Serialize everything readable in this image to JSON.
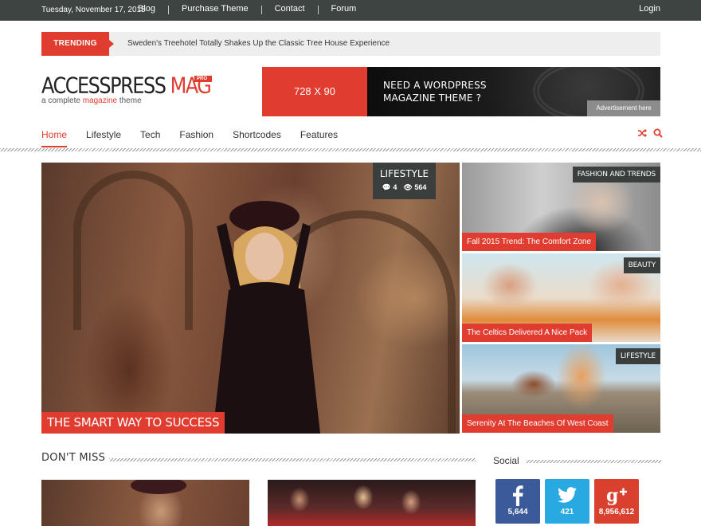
{
  "topbar": {
    "date": "Tuesday, November 17, 2015",
    "nav": [
      "Blog",
      "Purchase Theme",
      "Contact",
      "Forum"
    ],
    "login": "Login",
    "background": "#3d4442"
  },
  "trending": {
    "label": "TRENDING",
    "headline": "Sweden's Treehotel Totally Shakes Up the Classic Tree House Experience"
  },
  "logo": {
    "name_main": "ACCESSPRESS",
    "name_accent": "MAG",
    "badge": "PRO",
    "tagline_prefix": "a complete",
    "tagline_accent": "magazine",
    "tagline_suffix": "theme"
  },
  "ad": {
    "size": "728 X 90",
    "line1": "NEED A WORDPRESS",
    "line2": "MAGAZINE THEME ?",
    "link": "Advertisement here"
  },
  "mainnav": {
    "items": [
      "Home",
      "Lifestyle",
      "Tech",
      "Fashion",
      "Shortcodes",
      "Features"
    ],
    "active": "Home",
    "icons": [
      "shuffle-icon",
      "search-icon"
    ]
  },
  "hero": {
    "category": "LIFESTYLE",
    "comments": "4",
    "views": "564",
    "title": "THE SMART WAY TO SUCCESS"
  },
  "side_posts": [
    {
      "category": "FASHION AND TRENDS",
      "title": "Fall 2015 Trend: The Comfort Zone"
    },
    {
      "category": "BEAUTY",
      "title": "The Celtics Delivered A Nice Pack"
    },
    {
      "category": "LIFESTYLE",
      "title": "Serenity At The Beaches Of West Coast"
    }
  ],
  "dont_miss": {
    "heading": "DON'T MISS"
  },
  "social": {
    "heading": "Social",
    "items": [
      {
        "network": "facebook",
        "icon": "facebook-icon",
        "count": "5,644",
        "color": "#3b5a9a"
      },
      {
        "network": "twitter",
        "icon": "twitter-icon",
        "count": "421",
        "color": "#29a9e1"
      },
      {
        "network": "google-plus",
        "icon": "google-plus-icon",
        "count": "8,956,612",
        "color": "#d9412e"
      }
    ]
  },
  "colors": {
    "accent": "#e03c2f",
    "dark": "#3a3f3d"
  }
}
